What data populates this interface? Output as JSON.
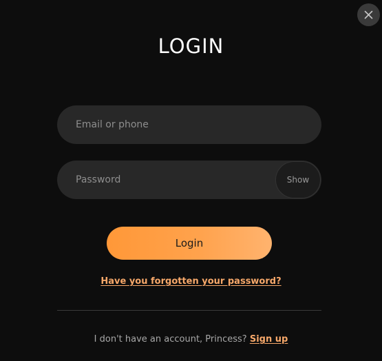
{
  "modal": {
    "title": "LOGIN",
    "close_icon": "close-icon"
  },
  "form": {
    "email_placeholder": "Email or phone",
    "email_value": "",
    "password_placeholder": "Password",
    "password_value": "",
    "show_label": "Show",
    "login_label": "Login",
    "forgot_label": "Have you forgotten your password?"
  },
  "footer": {
    "prompt": "I don't have an account, Princess? ",
    "signup_label": "Sign up"
  },
  "colors": {
    "background": "#0d0d0d",
    "field_bg": "#282828",
    "accent": "#ff9838",
    "link": "#f7a86a"
  }
}
